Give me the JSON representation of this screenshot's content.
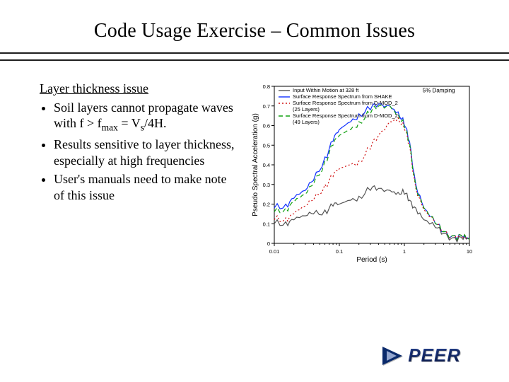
{
  "title": "Code Usage Exercise – Common Issues",
  "subhead": "Layer thickness issue",
  "bullets": [
    "Soil layers cannot propagate waves with f  > f<span class=\"sub\">max</span> = V<span class=\"sub\">s</span>/4H.",
    "Results sensitive to layer thickness, especially at high frequencies",
    "User's manuals need to make note of this issue"
  ],
  "footer_logo_text": "PEER",
  "chart_data": {
    "type": "line",
    "xscale": "log",
    "xlabel": "Period (s)",
    "ylabel": "Pseudo Spectral Acceleration (g)",
    "xlim": [
      0.01,
      10
    ],
    "ylim": [
      0,
      0.8
    ],
    "xticks": [
      0.01,
      0.1,
      1,
      10
    ],
    "yticks": [
      0,
      0.1,
      0.2,
      0.3,
      0.4,
      0.5,
      0.6,
      0.7,
      0.8
    ],
    "annotations": [
      {
        "text": "5% Damping",
        "x": 6,
        "y": 0.77
      }
    ],
    "series": [
      {
        "name": "Input Within Motion at 328 ft",
        "color": "#555555",
        "dash": "none",
        "x": [
          0.01,
          0.015,
          0.02,
          0.03,
          0.04,
          0.06,
          0.08,
          0.1,
          0.15,
          0.2,
          0.3,
          0.4,
          0.6,
          0.8,
          1,
          1.2,
          1.5,
          2,
          3,
          4,
          6,
          8,
          10
        ],
        "y": [
          0.1,
          0.11,
          0.12,
          0.14,
          0.15,
          0.17,
          0.19,
          0.2,
          0.22,
          0.24,
          0.27,
          0.28,
          0.27,
          0.26,
          0.25,
          0.22,
          0.18,
          0.12,
          0.08,
          0.05,
          0.03,
          0.02,
          0.02
        ]
      },
      {
        "name": "Surface Response Spectrum from SHAKE",
        "color": "#1030ff",
        "dash": "none",
        "x": [
          0.01,
          0.015,
          0.02,
          0.03,
          0.04,
          0.06,
          0.08,
          0.1,
          0.15,
          0.2,
          0.3,
          0.4,
          0.6,
          0.8,
          1,
          1.2,
          1.5,
          2,
          3,
          4,
          6,
          8,
          10
        ],
        "y": [
          0.18,
          0.2,
          0.23,
          0.27,
          0.32,
          0.44,
          0.52,
          0.58,
          0.62,
          0.66,
          0.68,
          0.71,
          0.7,
          0.67,
          0.6,
          0.52,
          0.3,
          0.18,
          0.1,
          0.06,
          0.04,
          0.03,
          0.02
        ]
      },
      {
        "name": "Surface Response Spectrum from D-MOD_2 (25 Layers)",
        "color": "#d01010",
        "dash": "dot",
        "x": [
          0.01,
          0.015,
          0.02,
          0.03,
          0.04,
          0.06,
          0.08,
          0.1,
          0.15,
          0.2,
          0.3,
          0.4,
          0.6,
          0.8,
          1,
          1.2,
          1.5,
          2,
          3,
          4,
          6,
          8,
          10
        ],
        "y": [
          0.12,
          0.13,
          0.15,
          0.19,
          0.22,
          0.3,
          0.34,
          0.38,
          0.4,
          0.42,
          0.48,
          0.55,
          0.62,
          0.64,
          0.58,
          0.5,
          0.28,
          0.17,
          0.1,
          0.06,
          0.04,
          0.03,
          0.02
        ]
      },
      {
        "name": "Surface Response Spectrum from D-MOD_2 (49 Layers)",
        "color": "#10a010",
        "dash": "dash",
        "x": [
          0.01,
          0.015,
          0.02,
          0.03,
          0.04,
          0.06,
          0.08,
          0.1,
          0.15,
          0.2,
          0.3,
          0.4,
          0.6,
          0.8,
          1,
          1.2,
          1.5,
          2,
          3,
          4,
          6,
          8,
          10
        ],
        "y": [
          0.16,
          0.18,
          0.21,
          0.25,
          0.3,
          0.42,
          0.5,
          0.55,
          0.58,
          0.62,
          0.66,
          0.7,
          0.7,
          0.66,
          0.59,
          0.51,
          0.29,
          0.18,
          0.1,
          0.06,
          0.04,
          0.03,
          0.02
        ]
      }
    ]
  }
}
